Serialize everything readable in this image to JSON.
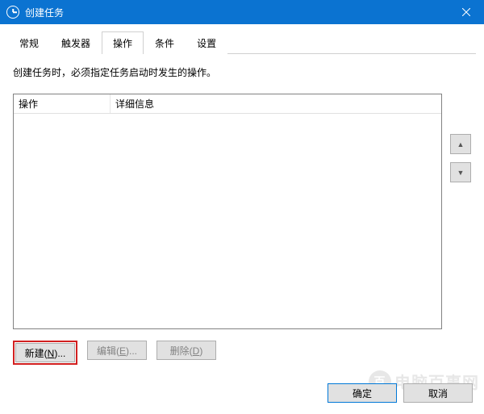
{
  "window": {
    "title": "创建任务",
    "close_label": "×"
  },
  "tabs": {
    "items": [
      {
        "label": "常规"
      },
      {
        "label": "触发器"
      },
      {
        "label": "操作"
      },
      {
        "label": "条件"
      },
      {
        "label": "设置"
      }
    ],
    "active_index": 2
  },
  "description": "创建任务时，必须指定任务启动时发生的操作。",
  "table": {
    "col1": "操作",
    "col2": "详细信息",
    "rows": []
  },
  "side": {
    "up": "▲",
    "down": "▼"
  },
  "actions": {
    "new": "新建(N)...",
    "edit": "编辑(E)...",
    "delete": "删除(D)"
  },
  "footer": {
    "ok": "确定",
    "cancel": "取消"
  },
  "watermark": "电脑百事网"
}
